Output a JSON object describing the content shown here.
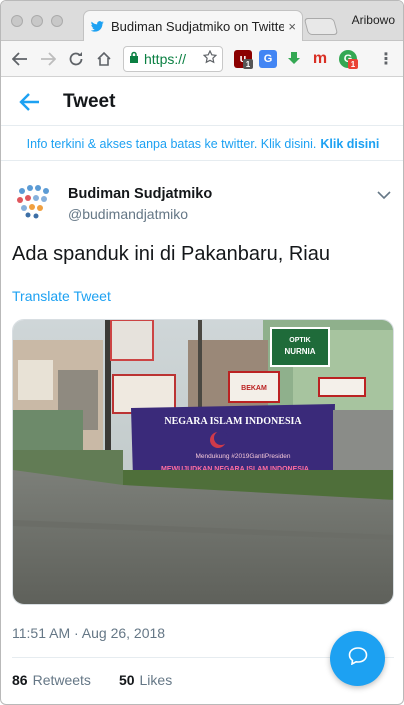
{
  "browser": {
    "tab_title": "Budiman Sudjatmiko on Twitter",
    "tab_close": "×",
    "profile_name": "Aribowo",
    "url_text": "https://",
    "ext_badges": [
      "1",
      "1"
    ]
  },
  "header": {
    "title": "Tweet"
  },
  "banner": {
    "text": "Info terkini & akses tanpa batas ke twitter. Klik disini.",
    "link": "Klik disini"
  },
  "tweet": {
    "author_name": "Budiman Sudjatmiko",
    "author_handle": "@budimandjatmiko",
    "text": "Ada spanduk ini di Pakanbaru, Riau",
    "translate_label": "Translate Tweet",
    "timestamp": "11:51 AM · Aug 26, 2018",
    "retweets_count": "86",
    "retweets_label": "Retweets",
    "likes_count": "50",
    "likes_label": "Likes"
  },
  "photo": {
    "banner_line1": "NEGARA ISLAM INDONESIA",
    "banner_line2": "Mendukung #2019GantiPresiden",
    "banner_line3": "MEWUJUDKAN NEGARA ISLAM INDONESIA",
    "sign_optik": "OPTIK",
    "sign_nurnia": "NURNIA",
    "sign_bekam": "BEKAM"
  },
  "colors": {
    "accent": "#1da1f2",
    "text": "#14171a",
    "muted": "#657786"
  }
}
